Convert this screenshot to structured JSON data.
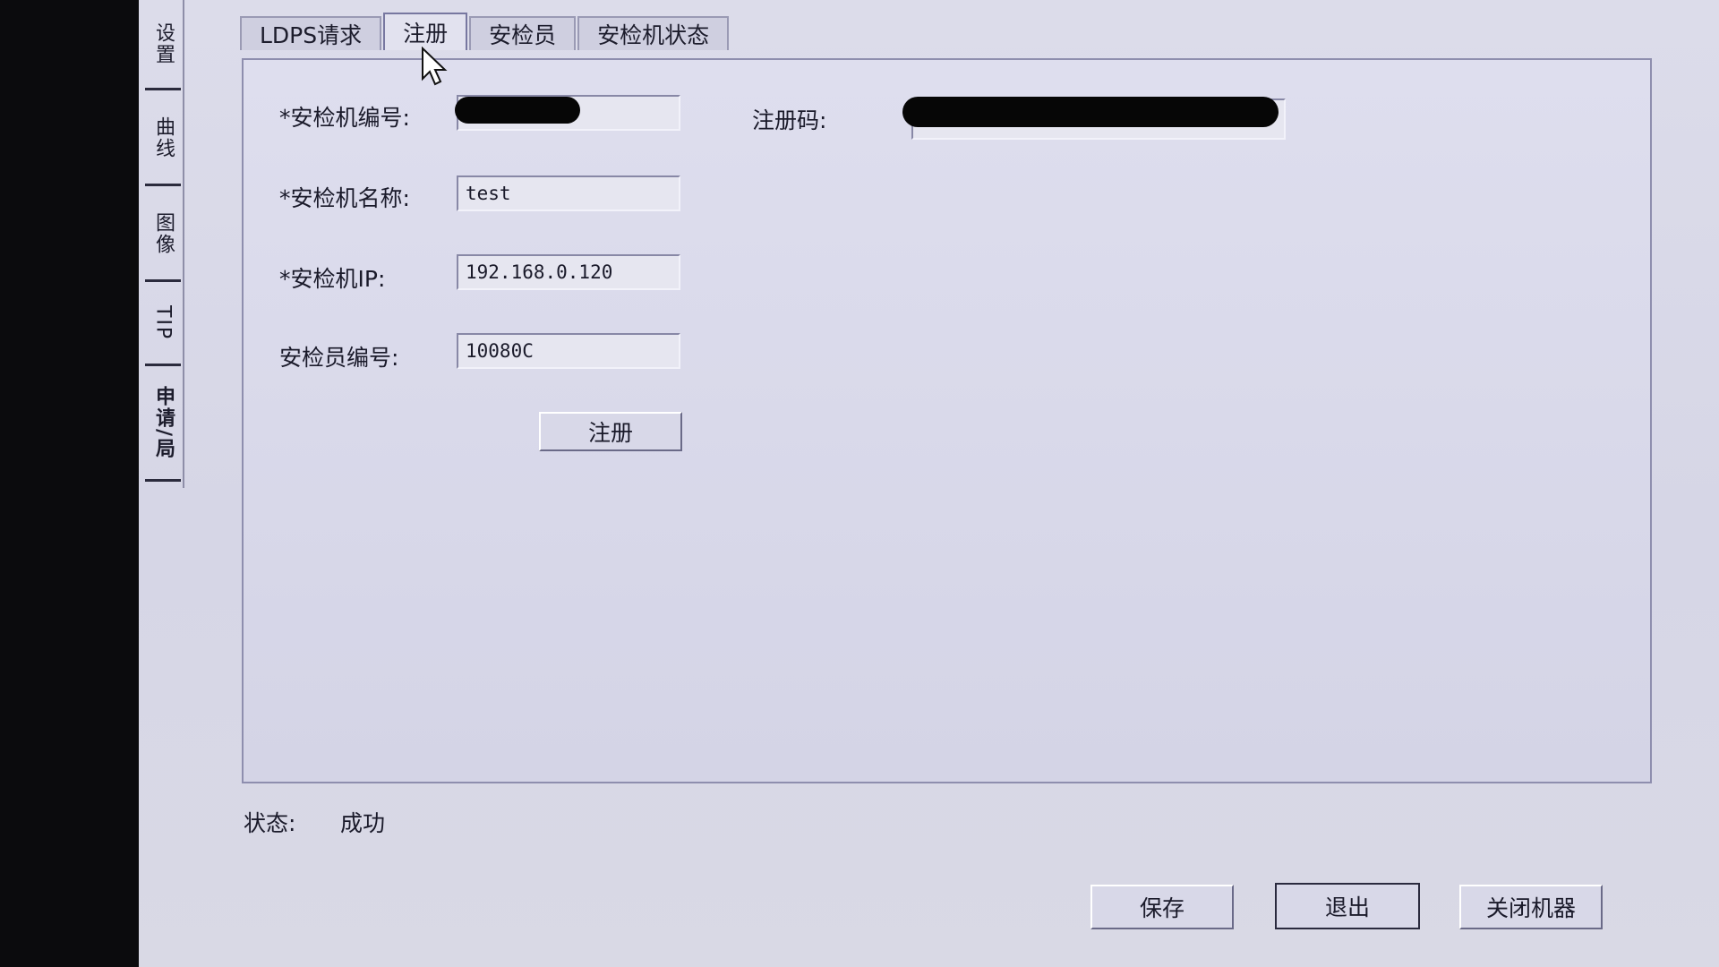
{
  "side_tabs": [
    "设置",
    "曲线",
    "图像",
    "TIP",
    "申请/局"
  ],
  "tabs": [
    "LDPS请求",
    "注册",
    "安检员",
    "安检机状态"
  ],
  "form": {
    "machine_id_label": "*安检机编号:",
    "machine_id_value": "",
    "machine_name_label": "*安检机名称:",
    "machine_name_value": "test",
    "machine_ip_label": "*安检机IP:",
    "machine_ip_value": "192.168.0.120",
    "inspector_id_label": "安检员编号:",
    "inspector_id_value": "10080C",
    "reg_code_label": "注册码:",
    "reg_code_value": "",
    "register_button": "注册"
  },
  "status": {
    "label": "状态:",
    "value": "成功"
  },
  "footer": {
    "save": "保存",
    "exit": "退出",
    "shutdown": "关闭机器"
  }
}
